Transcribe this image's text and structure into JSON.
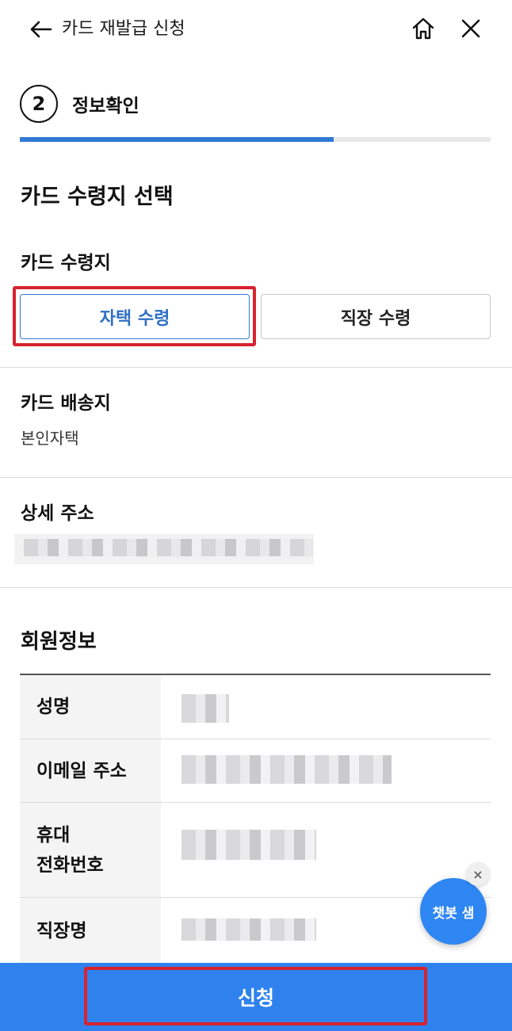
{
  "header": {
    "title": "카드 재발급 신청",
    "back_icon": "arrow-left-icon",
    "home_icon": "home-icon",
    "close_icon": "close-icon"
  },
  "step": {
    "number": "2",
    "label": "정보확인",
    "progress_fraction": 0.667,
    "progress_color": "#3279d6"
  },
  "section": {
    "title": "카드 수령지 선택"
  },
  "pickup": {
    "label": "카드 수령지",
    "options": [
      "자택 수령",
      "직장 수령"
    ],
    "selected": "자택 수령"
  },
  "delivery": {
    "label": "카드 배송지",
    "value": "본인자택"
  },
  "address": {
    "label": "상세 주소"
  },
  "member": {
    "title": "회원정보",
    "rows": [
      "성명",
      "이메일 주소",
      "휴대\n전화번호",
      "직장명"
    ]
  },
  "chatbot": {
    "label": "챗봇 샘",
    "close_label": "×"
  },
  "submit": {
    "label": "신청",
    "color": "#2f82ee"
  },
  "accent_color": "#3279d6",
  "highlight_color": "#d8232f"
}
